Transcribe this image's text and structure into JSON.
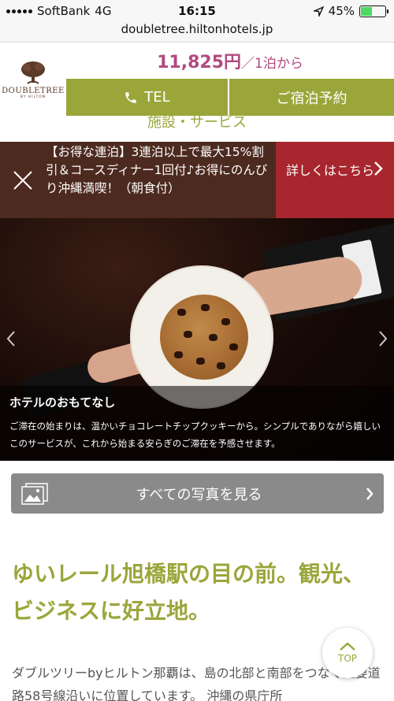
{
  "status_bar": {
    "carrier": "SoftBank",
    "network": "4G",
    "time": "16:15",
    "battery": "45%",
    "battery_level": 0.45
  },
  "browser": {
    "url": "doubletree.hiltonhotels.jp"
  },
  "header": {
    "logo": {
      "name": "DOUBLETREE",
      "sub": "BY HILTON"
    },
    "price": "11,825円",
    "price_suffix": "／1泊から",
    "tel_label": "TEL",
    "reserve_label": "ご宿泊予約",
    "nav_peek": "施設・サービス"
  },
  "promo": {
    "text": "【お得な連泊】3連泊以上で最大15%割引＆コースディナー1回付♪お得にのんびり沖縄満喫！（朝食付）",
    "link_label": "詳しくはこちら"
  },
  "hero": {
    "caption_title": "ホテルのおもてなし",
    "caption_body": "ご滞在の始まりは、温かいチョコレートチップクッキーから。シンプルでありながら嬉しい このサービスが、これから始まる安らぎのご滞在を予感させます。"
  },
  "photos_button": {
    "label": "すべての写真を見る"
  },
  "headline": "ゆいレール旭橋駅の目の前。観光、ビジネスに好立地。",
  "paragraph": "ダブルツリーbyヒルトン那覇は、島の北部と南部をつなぐ主要道路58号線沿いに位置しています。 沖縄の県庁所",
  "top_button": {
    "label": "TOP"
  },
  "colors": {
    "accent_green": "#9aa63a",
    "price_magenta": "#b14a80",
    "promo_brown": "#4d2a1f",
    "promo_red": "#a8262e",
    "button_gray": "#8a8a8a"
  },
  "icons": [
    "location-arrow-icon",
    "battery-icon",
    "phone-icon",
    "close-icon",
    "chevron-right-icon",
    "chevron-left-icon",
    "picture-icon",
    "chevron-up-icon"
  ]
}
